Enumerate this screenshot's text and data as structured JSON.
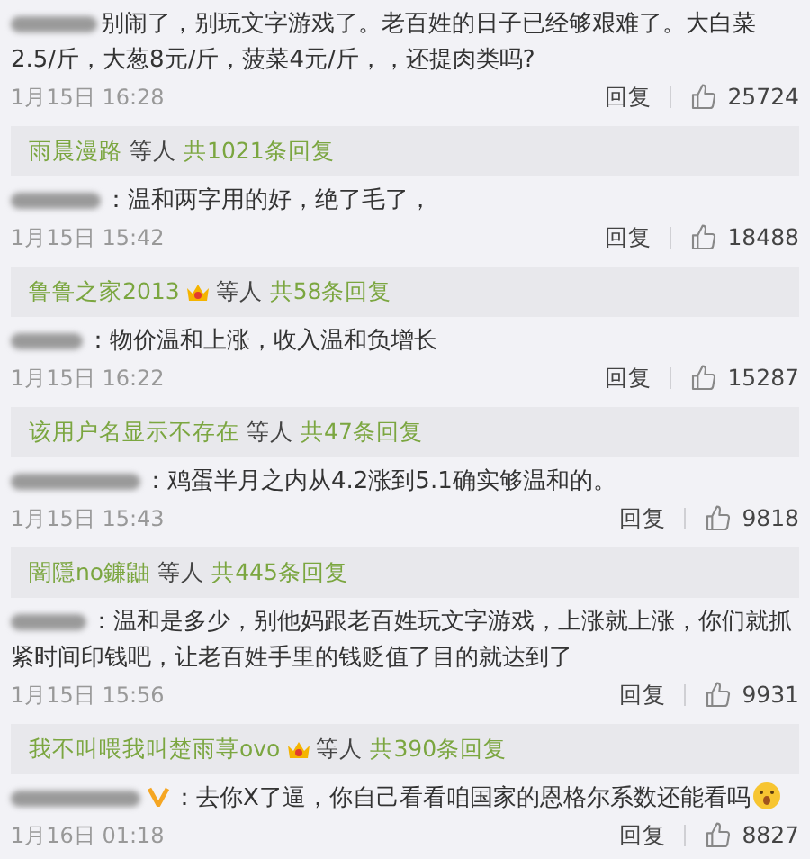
{
  "comments": [
    {
      "name_redacted": true,
      "verified": false,
      "text": "别闹了，别玩文字游戏了。老百姓的日子已经够艰难了。大白菜2.5/斤，大葱8元/斤，菠菜4元/斤，，还提肉类吗?",
      "emoji": false,
      "time": "1月15日 16:28",
      "reply_label": "回复",
      "likes": "25724",
      "replies": {
        "name": "雨晨漫路",
        "crown": false,
        "suffix": "等人",
        "count": "共1021条回复"
      }
    },
    {
      "name_redacted": true,
      "verified": false,
      "text": "：温和两字用的好，绝了毛了，",
      "emoji": false,
      "time": "1月15日 15:42",
      "reply_label": "回复",
      "likes": "18488",
      "replies": {
        "name": "鲁鲁之家2013",
        "crown": true,
        "suffix": "等人",
        "count": "共58条回复"
      }
    },
    {
      "name_redacted": true,
      "verified": false,
      "text": "：物价温和上涨，收入温和负增长",
      "emoji": false,
      "time": "1月15日 16:22",
      "reply_label": "回复",
      "likes": "15287",
      "replies": {
        "name": "该用户名显示不存在",
        "crown": false,
        "suffix": "等人",
        "count": "共47条回复"
      }
    },
    {
      "name_redacted": true,
      "verified": false,
      "text": "：鸡蛋半月之内从4.2涨到5.1确实够温和的。",
      "emoji": false,
      "time": "1月15日 15:43",
      "reply_label": "回复",
      "likes": "9818",
      "replies": {
        "name": "闇隱no鐮鼬",
        "crown": false,
        "suffix": "等人",
        "count": "共445条回复"
      }
    },
    {
      "name_redacted": true,
      "verified": false,
      "text": "：温和是多少，别他妈跟老百姓玩文字游戏，上涨就上涨，你们就抓紧时间印钱吧，让老百姓手里的钱贬值了目的就达到了",
      "emoji": false,
      "time": "1月15日 15:56",
      "reply_label": "回复",
      "likes": "9931",
      "replies": {
        "name": "我不叫喂我叫楚雨荨ovo",
        "crown": true,
        "suffix": "等人",
        "count": "共390条回复"
      }
    },
    {
      "name_redacted": true,
      "verified": true,
      "text": "：去你X了逼，你自己看看咱国家的恩格尔系数还能看吗",
      "emoji": true,
      "time": "1月16日 01:18",
      "reply_label": "回复",
      "likes": "8827"
    }
  ]
}
